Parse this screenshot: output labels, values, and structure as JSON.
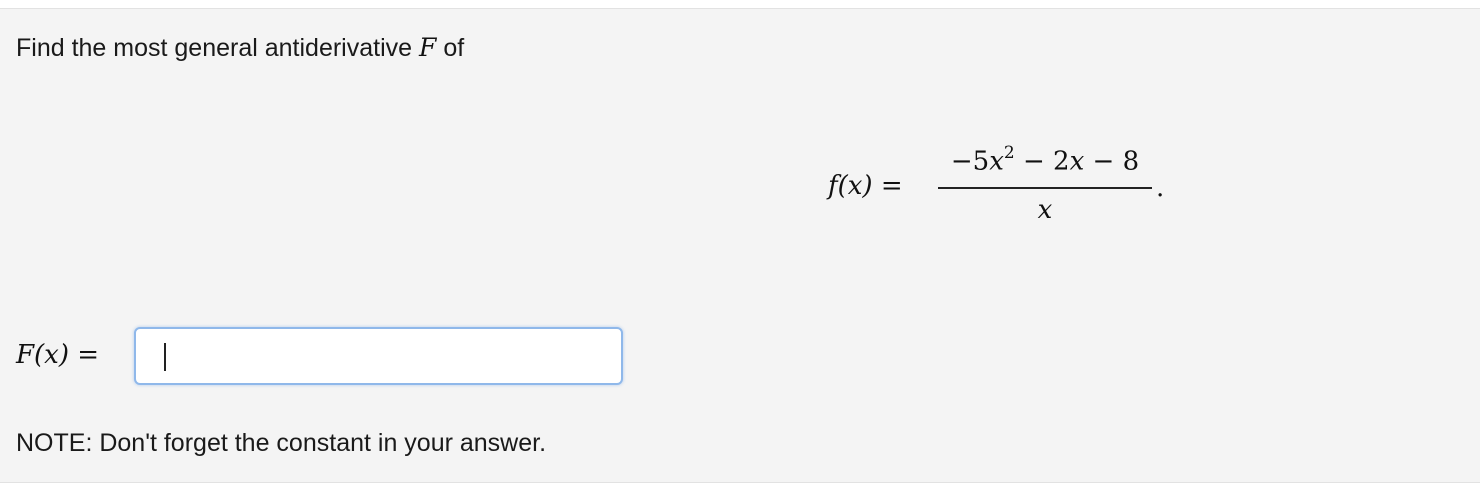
{
  "question": {
    "prompt_text": "Find the most general antiderivative",
    "prompt_var": "F",
    "prompt_suffix": "of"
  },
  "equation": {
    "lhs": "f(x) =",
    "numerator_lead": "−5",
    "numerator_var": "x",
    "numerator_exp": "2",
    "numerator_tail": " − 2",
    "numerator_tail_var": "x",
    "numerator_const": " − 8",
    "denominator": "x",
    "period": "."
  },
  "answer": {
    "label": "F(x) =",
    "value": "",
    "placeholder": ""
  },
  "note": {
    "text": "NOTE: Don't forget the constant in your answer."
  }
}
